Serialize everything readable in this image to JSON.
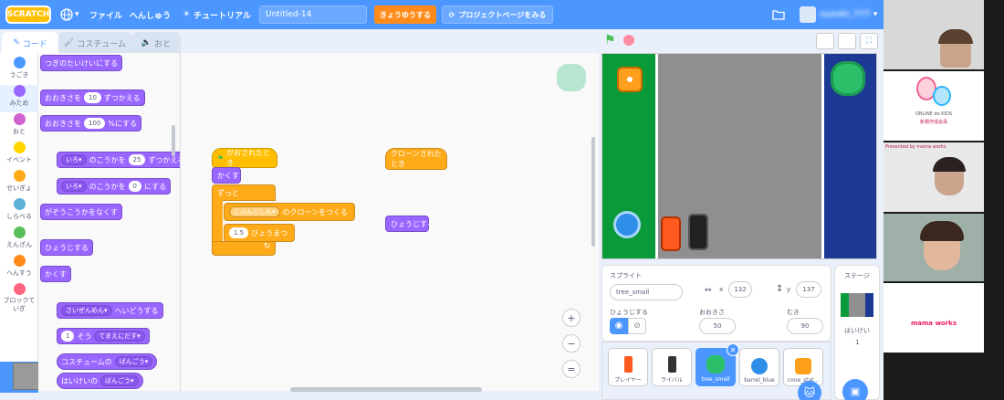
{
  "menubar": {
    "logo": "SCRATCH",
    "file": "ファイル",
    "edit": "へんしゅう",
    "tutorial": "チュートリアル",
    "project_title": "Untitled-14",
    "share": "きょうゆうする",
    "project_page": "プロジェクトページをみる",
    "username": "suzuki_777"
  },
  "tabs": {
    "code": "コード",
    "costume": "コスチューム",
    "sound": "おと"
  },
  "categories": [
    {
      "label": "うごき",
      "color": "#4c97ff"
    },
    {
      "label": "みため",
      "color": "#9966ff"
    },
    {
      "label": "おと",
      "color": "#cf63cf"
    },
    {
      "label": "イベント",
      "color": "#ffd500"
    },
    {
      "label": "せいぎょ",
      "color": "#ffab19"
    },
    {
      "label": "しらべる",
      "color": "#5cb1d6"
    },
    {
      "label": "えんざん",
      "color": "#59c059"
    },
    {
      "label": "へんすう",
      "color": "#ff8c1a"
    },
    {
      "label": "ブロックていぎ",
      "color": "#ff6680"
    }
  ],
  "palette": {
    "b0": "つぎのたいけいにする",
    "b1a": "おおきさを",
    "b1v": "10",
    "b1b": "ずつかえる",
    "b2a": "おおきさを",
    "b2v": "100",
    "b2b": "%にする",
    "b3a": "いろ",
    "b3b": "のこうかを",
    "b3v": "25",
    "b3c": "ずつかえる",
    "b4a": "いろ",
    "b4b": "のこうかを",
    "b4v": "0",
    "b4c": "にする",
    "b5": "がぞうこうかをなくす",
    "b6": "ひょうじする",
    "b7": "かくす",
    "b8a": "さいぜんめん",
    "b8b": "へいどうする",
    "b9v": "1",
    "b9a": "そう",
    "b9b": "てまえにだす",
    "b10a": "コスチュームの",
    "b10b": "ばんごう",
    "b11a": "はいけいの",
    "b11b": "ばんごう"
  },
  "script": {
    "flag": "がおされたとき",
    "hide": "かくす",
    "forever": "ずっと",
    "clone_a": "じぶんじしん",
    "clone_b": "のクローンをつくる",
    "wait_v": "1.5",
    "wait_t": "びょうまつ",
    "when_clone": "クローンされたとき",
    "show": "ひょうじする"
  },
  "sprite_info": {
    "label": "スプライト",
    "name": "tree_small",
    "x_label": "x",
    "x": "132",
    "y_label": "y",
    "y": "137",
    "show_label": "ひょうじする",
    "size_label": "おおきさ",
    "size": "50",
    "dir_label": "むき",
    "direction": "90"
  },
  "sprites": [
    "プレイヤー",
    "ライバル",
    "tree_small",
    "barrel_blue",
    "cone_stat..."
  ],
  "stage_pane": {
    "label": "ステージ",
    "bg_label": "はいけい",
    "bg_count": "1"
  },
  "video": {
    "logo_line1": "ONLINE de KIDS",
    "logo_line2": "新規作成会員",
    "presented": "Presented by mama works",
    "logo2": "mama works"
  }
}
